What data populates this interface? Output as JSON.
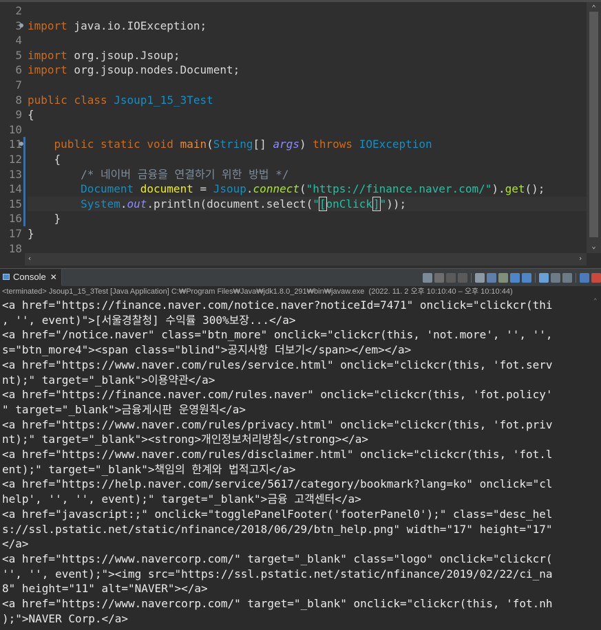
{
  "editor": {
    "line_numbers": [
      "2",
      "3",
      "4",
      "5",
      "6",
      "7",
      "8",
      "9",
      "10",
      "11",
      "12",
      "13",
      "14",
      "15",
      "16",
      "17",
      "18"
    ],
    "lines": [
      [],
      [
        {
          "c": "kw",
          "t": "import"
        },
        {
          "c": "plain",
          "t": " java.io.IOException;"
        }
      ],
      [],
      [
        {
          "c": "kw",
          "t": "import"
        },
        {
          "c": "plain",
          "t": " org.jsoup.Jsoup;"
        }
      ],
      [
        {
          "c": "kw",
          "t": "import"
        },
        {
          "c": "plain",
          "t": " org.jsoup.nodes.Document;"
        }
      ],
      [],
      [
        {
          "c": "kw",
          "t": "public"
        },
        {
          "c": "plain",
          "t": " "
        },
        {
          "c": "kw",
          "t": "class"
        },
        {
          "c": "plain",
          "t": " "
        },
        {
          "c": "cls",
          "t": "Jsoup1_15_3Test"
        }
      ],
      [
        {
          "c": "plain",
          "t": "{"
        }
      ],
      [],
      [
        {
          "c": "plain",
          "t": "    "
        },
        {
          "c": "kw",
          "t": "public"
        },
        {
          "c": "plain",
          "t": " "
        },
        {
          "c": "kw",
          "t": "static"
        },
        {
          "c": "plain",
          "t": " "
        },
        {
          "c": "kw",
          "t": "void"
        },
        {
          "c": "plain",
          "t": " "
        },
        {
          "c": "kw2",
          "t": "main"
        },
        {
          "c": "plain",
          "t": "("
        },
        {
          "c": "cls",
          "t": "String"
        },
        {
          "c": "plain",
          "t": "[] "
        },
        {
          "c": "fld",
          "t": "args"
        },
        {
          "c": "plain",
          "t": ") "
        },
        {
          "c": "kw",
          "t": "throws"
        },
        {
          "c": "plain",
          "t": " "
        },
        {
          "c": "cls",
          "t": "IOException"
        }
      ],
      [
        {
          "c": "plain",
          "t": "    {"
        }
      ],
      [
        {
          "c": "plain",
          "t": "        "
        },
        {
          "c": "cmt",
          "t": "/* 네이버 금융을 연결하기 위한 방법 */"
        }
      ],
      [
        {
          "c": "plain",
          "t": "        "
        },
        {
          "c": "cls",
          "t": "Document"
        },
        {
          "c": "plain",
          "t": " "
        },
        {
          "c": "var",
          "t": "document"
        },
        {
          "c": "plain",
          "t": " = "
        },
        {
          "c": "cls",
          "t": "Jsoup"
        },
        {
          "c": "plain",
          "t": "."
        },
        {
          "c": "mthi",
          "t": "connect"
        },
        {
          "c": "plain",
          "t": "("
        },
        {
          "c": "str",
          "t": "\"https://finance.naver.com/\""
        },
        {
          "c": "plain",
          "t": ")."
        },
        {
          "c": "mth",
          "t": "get"
        },
        {
          "c": "plain",
          "t": "();"
        }
      ],
      [
        {
          "c": "plain",
          "t": "        "
        },
        {
          "c": "cls",
          "t": "System"
        },
        {
          "c": "plain",
          "t": "."
        },
        {
          "c": "fld",
          "t": "out"
        },
        {
          "c": "plain",
          "t": ".println(document.select("
        },
        {
          "c": "str",
          "t": "\""
        },
        {
          "c": "str boxed",
          "t": "["
        },
        {
          "c": "str",
          "t": "onClick"
        },
        {
          "c": "caret",
          "t": ""
        },
        {
          "c": "str boxed",
          "t": "]"
        },
        {
          "c": "str",
          "t": "\""
        },
        {
          "c": "plain",
          "t": "));"
        }
      ],
      [
        {
          "c": "plain",
          "t": "    }"
        }
      ],
      [
        {
          "c": "plain",
          "t": "}"
        }
      ],
      []
    ]
  },
  "console": {
    "tab_label": "Console",
    "close_label": "✕",
    "status": "<terminated> Jsoup1_15_3Test [Java Application] C:₩Program Files₩Java₩jdk1.8.0_291₩bin₩javaw.exe  (2022. 11. 2 오후 10:10:40 – 오후 10:10:44)",
    "output": [
      "<a href=\"https://finance.naver.com/notice.naver?noticeId=7471\" onclick=\"clickcr(thi",
      ", '', event)\">[서울경찰청] 수익률 300%보장...</a>",
      "<a href=\"/notice.naver\" class=\"btn_more\" onclick=\"clickcr(this, 'not.more', '', '',",
      "s=\"btn_more4\"><span class=\"blind\">공지사항 더보기</span></em></a>",
      "<a href=\"https://www.naver.com/rules/service.html\" onclick=\"clickcr(this, 'fot.serv",
      "nt);\" target=\"_blank\">이용약관</a>",
      "<a href=\"https://finance.naver.com/rules.naver\" onclick=\"clickcr(this, 'fot.policy'",
      "\" target=\"_blank\">금융게시판 운영원칙</a>",
      "<a href=\"https://www.naver.com/rules/privacy.html\" onclick=\"clickcr(this, 'fot.priv",
      "nt);\" target=\"_blank\"><strong>개인정보처리방침</strong></a>",
      "<a href=\"https://www.naver.com/rules/disclaimer.html\" onclick=\"clickcr(this, 'fot.l",
      "ent);\" target=\"_blank\">책임의 한계와 법적고지</a>",
      "<a href=\"https://help.naver.com/service/5617/category/bookmark?lang=ko\" onclick=\"cl",
      "help', '', '', event);\" target=\"_blank\">금융 고객센터</a>",
      "<a href=\"javascript:;\" onclick=\"togglePanelFooter('footerPanel0');\" class=\"desc_hel",
      "s://ssl.pstatic.net/static/nfinance/2018/06/29/btn_help.png\" width=\"17\" height=\"17\"",
      "</a>",
      "<a href=\"https://www.navercorp.com/\" target=\"_blank\" class=\"logo\" onclick=\"clickcr(",
      "'', '', event);\"><img src=\"https://ssl.pstatic.net/static/nfinance/2019/02/22/ci_na",
      "8\" height=\"11\" alt=\"NAVER\"></a>",
      "<a href=\"https://www.navercorp.com/\" target=\"_blank\" onclick=\"clickcr(this, 'fot.nh",
      ");\">NAVER Corp.</a>"
    ]
  },
  "colors": {
    "editor_bg": "#2f2f2f",
    "keyword": "#cc6c1d",
    "class": "#1290c3",
    "string": "#17c6a3",
    "console_bg": "#2b2b2b"
  }
}
